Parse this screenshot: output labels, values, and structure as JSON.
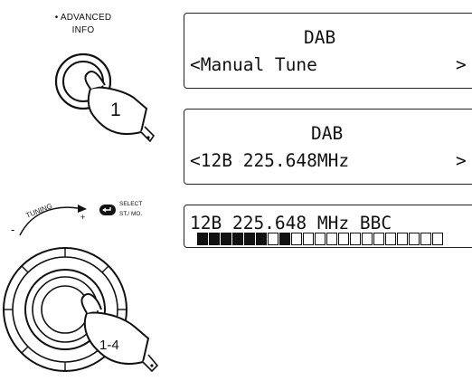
{
  "info_button": {
    "label_line1": "• ADVANCED",
    "label_line2": "INFO",
    "step": "1"
  },
  "tuning_control": {
    "tuning_label": "TUNING",
    "minus": "-",
    "plus": "+",
    "select_label_line1": "SELECT",
    "select_label_line2": "ST./ MO.",
    "step": "1-4"
  },
  "displays": [
    {
      "line1": "DAB",
      "line2_left": "<Manual Tune",
      "line2_right": ">"
    },
    {
      "line1": "DAB",
      "line2_left": "<12B 225.648MHz",
      "line2_right": ">"
    },
    {
      "line1": "12B 225.648 MHz BBC"
    }
  ],
  "signal_meter": {
    "filled": [
      1,
      1,
      1,
      1,
      1,
      1,
      0,
      1,
      0,
      0,
      0,
      0,
      0,
      0,
      0,
      0,
      0,
      0,
      0,
      0,
      0
    ]
  }
}
